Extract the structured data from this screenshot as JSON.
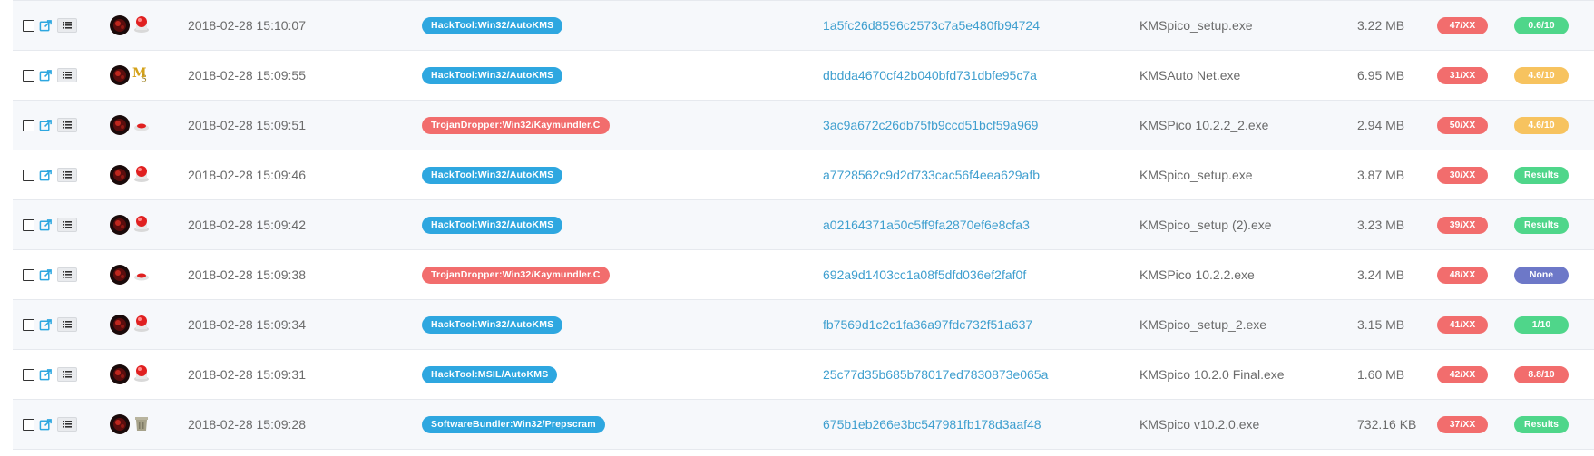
{
  "colors": {
    "blue_pill": "#2ea7e0",
    "red_pill": "#f26d6d",
    "green": "#4fd68a",
    "orange": "#f7c35f",
    "purple": "#6d78c8",
    "hash_link": "#3f9fcf"
  },
  "icons": {
    "row_actions": [
      "checkbox",
      "external-link-icon",
      "list-icon"
    ],
    "row_visuals": [
      "malware-avatar-icon",
      "sub-icon"
    ]
  },
  "rows": [
    {
      "date": "2018-02-28 15:10:07",
      "threat": "HackTool:Win32/AutoKMS",
      "threat_color": "blue",
      "hash": "1a5fc26d8596c2573c7a5e480fb94724",
      "file": "KMSpico_setup.exe",
      "size": "3.22 MB",
      "detections": "47/XX",
      "score": "0.6/10",
      "score_color": "green",
      "sub_icon": "red-button"
    },
    {
      "date": "2018-02-28 15:09:55",
      "threat": "HackTool:Win32/AutoKMS",
      "threat_color": "blue",
      "hash": "dbdda4670cf42b040bfd731dbfe95c7a",
      "file": "KMSAuto Net.exe",
      "size": "6.95 MB",
      "detections": "31/XX",
      "score": "4.6/10",
      "score_color": "orange",
      "sub_icon": "ms-logo"
    },
    {
      "date": "2018-02-28 15:09:51",
      "threat": "TrojanDropper:Win32/Kaymundler.C",
      "threat_color": "red",
      "hash": "3ac9a672c26db75fb9ccd51bcf59a969",
      "file": "KMSPico 10.2.2_2.exe",
      "size": "2.94 MB",
      "detections": "50/XX",
      "score": "4.6/10",
      "score_color": "orange",
      "sub_icon": "red-button-small"
    },
    {
      "date": "2018-02-28 15:09:46",
      "threat": "HackTool:Win32/AutoKMS",
      "threat_color": "blue",
      "hash": "a7728562c9d2d733cac56f4eea629afb",
      "file": "KMSpico_setup.exe",
      "size": "3.87 MB",
      "detections": "30/XX",
      "score": "Results",
      "score_color": "green",
      "sub_icon": "red-button"
    },
    {
      "date": "2018-02-28 15:09:42",
      "threat": "HackTool:Win32/AutoKMS",
      "threat_color": "blue",
      "hash": "a02164371a50c5ff9fa2870ef6e8cfa3",
      "file": "KMSpico_setup (2).exe",
      "size": "3.23 MB",
      "detections": "39/XX",
      "score": "Results",
      "score_color": "green",
      "sub_icon": "red-button"
    },
    {
      "date": "2018-02-28 15:09:38",
      "threat": "TrojanDropper:Win32/Kaymundler.C",
      "threat_color": "red",
      "hash": "692a9d1403cc1a08f5dfd036ef2faf0f",
      "file": "KMSPico 10.2.2.exe",
      "size": "3.24 MB",
      "detections": "48/XX",
      "score": "None",
      "score_color": "purple",
      "sub_icon": "red-button-small"
    },
    {
      "date": "2018-02-28 15:09:34",
      "threat": "HackTool:Win32/AutoKMS",
      "threat_color": "blue",
      "hash": "fb7569d1c2c1fa36a97fdc732f51a637",
      "file": "KMSpico_setup_2.exe",
      "size": "3.15 MB",
      "detections": "41/XX",
      "score": "1/10",
      "score_color": "green",
      "sub_icon": "red-button"
    },
    {
      "date": "2018-02-28 15:09:31",
      "threat": "HackTool:MSIL/AutoKMS",
      "threat_color": "blue",
      "hash": "25c77d35b685b78017ed7830873e065a",
      "file": "KMSpico 10.2.0 Final.exe",
      "size": "1.60 MB",
      "detections": "42/XX",
      "score": "8.8/10",
      "score_color": "red",
      "sub_icon": "red-button"
    },
    {
      "date": "2018-02-28 15:09:28",
      "threat": "SoftwareBundler:Win32/Prepscram",
      "threat_color": "blue",
      "hash": "675b1eb266e3bc547981fb178d3aaf48",
      "file": "KMSpico v10.2.0.exe",
      "size": "732.16 KB",
      "detections": "37/XX",
      "score": "Results",
      "score_color": "green",
      "sub_icon": "trash-can"
    }
  ]
}
